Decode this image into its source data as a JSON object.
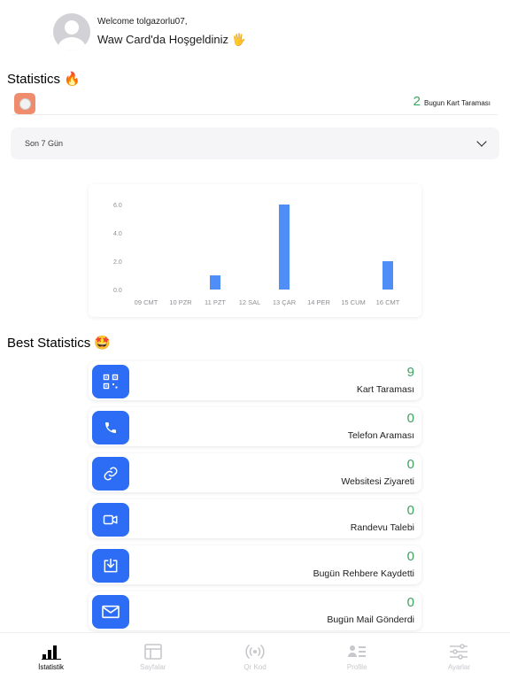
{
  "header": {
    "welcome": "Welcome tolgazorlu07,",
    "greeting": "Waw Card'da Hoşgeldiniz 🖐"
  },
  "statistics": {
    "title": "Statistics 🔥",
    "today_count": "2",
    "today_label": "Bugun Kart Taraması",
    "period": "Son 7 Gün"
  },
  "chart_data": {
    "type": "bar",
    "categories": [
      "09 CMT",
      "10 PZR",
      "11 PZT",
      "12 SAL",
      "13 ÇAR",
      "14 PER",
      "15 CUM",
      "16 CMT"
    ],
    "values": [
      0,
      0,
      1,
      0,
      6,
      0,
      0,
      2
    ],
    "yticks": [
      "0.0",
      "2.0",
      "4.0",
      "6.0"
    ],
    "ylim": [
      0,
      6
    ],
    "color": "#4f8ef7",
    "grid": false,
    "legend": "none"
  },
  "best": {
    "title": "Best Statistics 🤩",
    "items": [
      {
        "value": "9",
        "label": "Kart Taraması",
        "icon": "qr-code-icon"
      },
      {
        "value": "0",
        "label": "Telefon Araması",
        "icon": "phone-icon"
      },
      {
        "value": "0",
        "label": "Websitesi Ziyareti",
        "icon": "link-icon"
      },
      {
        "value": "0",
        "label": "Randevu Talebi",
        "icon": "video-camera-icon"
      },
      {
        "value": "0",
        "label": "Bugün Rehbere Kaydetti",
        "icon": "download-icon"
      },
      {
        "value": "0",
        "label": "Bugün Mail Gönderdi",
        "icon": "mail-icon"
      }
    ]
  },
  "tabs": [
    {
      "label": "İstatistik",
      "icon": "bar-chart-icon",
      "active": true
    },
    {
      "label": "Sayfalar",
      "icon": "layout-icon",
      "active": false
    },
    {
      "label": "Qr Kod",
      "icon": "broadcast-icon",
      "active": false
    },
    {
      "label": "Profile",
      "icon": "profile-card-icon",
      "active": false
    },
    {
      "label": "Ayarlar",
      "icon": "sliders-icon",
      "active": false
    }
  ],
  "colors": {
    "accent": "#2d6df5",
    "positive": "#3da35d",
    "bar": "#4f8ef7"
  }
}
